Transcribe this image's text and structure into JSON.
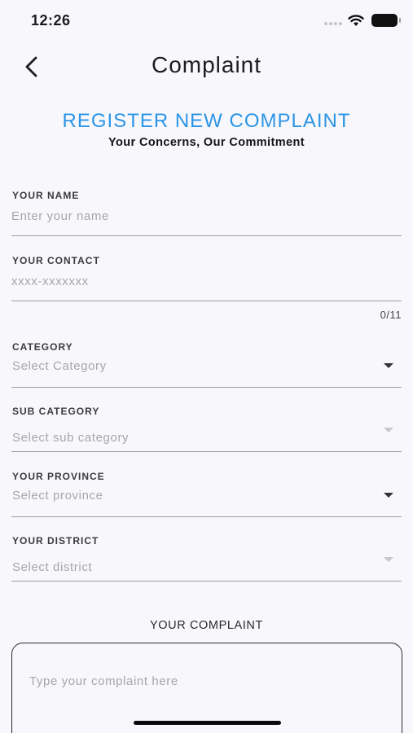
{
  "status_bar": {
    "time": "12:26"
  },
  "nav": {
    "title": "Complaint",
    "back_icon": "chevron-left-icon"
  },
  "header": {
    "title": "REGISTER NEW COMPLAINT",
    "subtitle": "Your Concerns, Our Commitment",
    "accent_color": "#2b95e6"
  },
  "form": {
    "name": {
      "label": "YOUR NAME",
      "placeholder": "Enter your name",
      "value": ""
    },
    "contact": {
      "label": "YOUR CONTACT",
      "placeholder": "xxxx-xxxxxxx",
      "value": "",
      "counter": "0/11"
    },
    "category": {
      "label": "CATEGORY",
      "placeholder": "Select Category",
      "enabled": true
    },
    "sub_category": {
      "label": "SUB CATEGORY",
      "placeholder": "Select sub category",
      "enabled": false
    },
    "province": {
      "label": "YOUR PROVINCE",
      "placeholder": "Select province",
      "enabled": true
    },
    "district": {
      "label": "YOUR DISTRICT",
      "placeholder": "Select district",
      "enabled": false
    },
    "complaint": {
      "label": "YOUR COMPLAINT",
      "placeholder": "Type your complaint here",
      "value": ""
    }
  }
}
